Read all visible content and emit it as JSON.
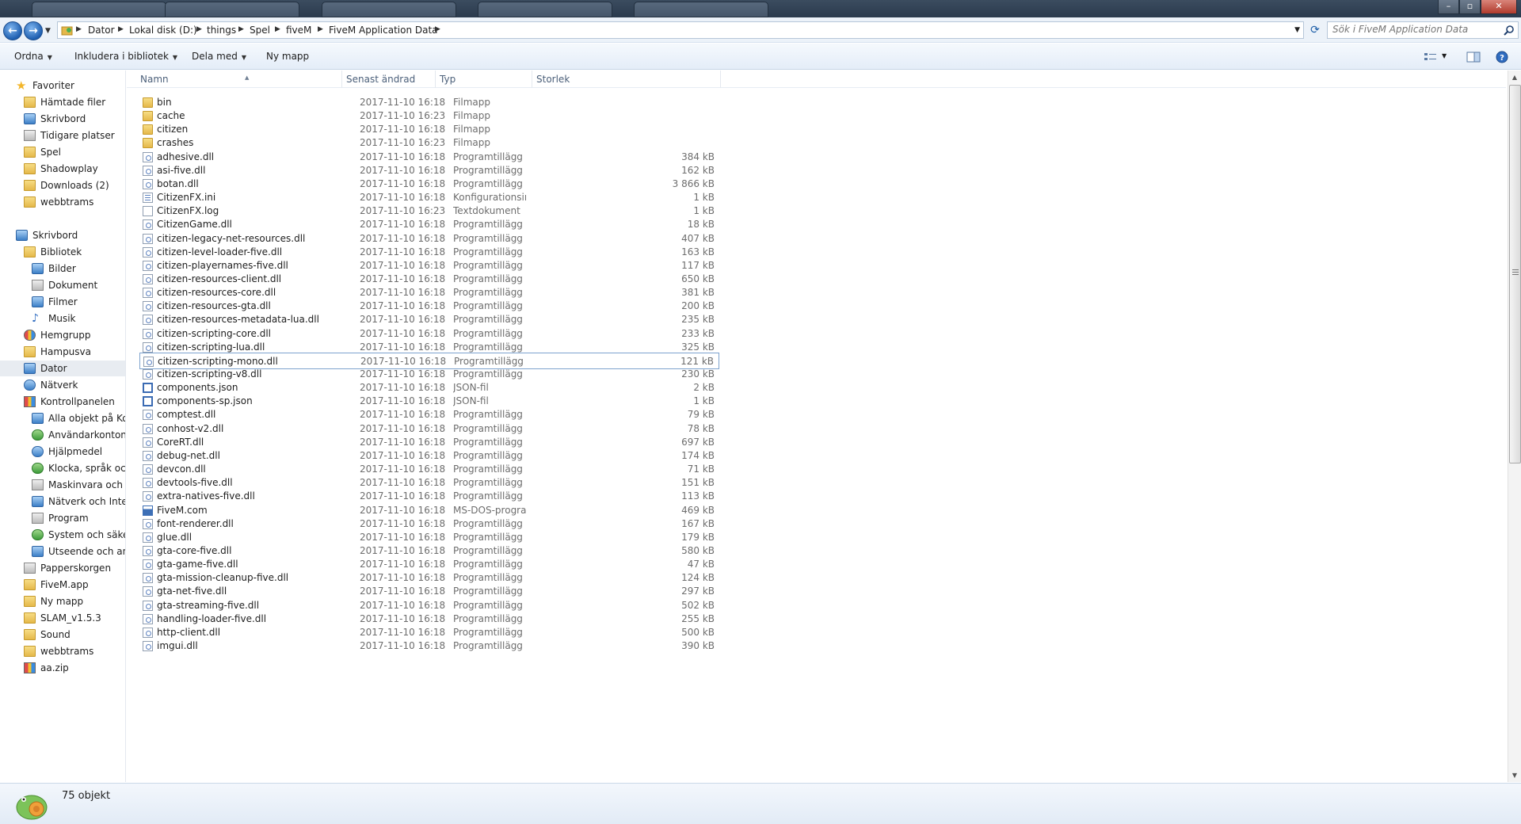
{
  "address_bar": {
    "crumbs": [
      "Dator",
      "Lokal disk (D:)",
      "things",
      "Spel",
      "fiveM",
      "FiveM Application Data"
    ],
    "search_placeholder": "Sök i FiveM Application Data"
  },
  "toolbar": {
    "organize": "Ordna",
    "include_library": "Inkludera i bibliotek",
    "share_with": "Dela med",
    "new_folder": "Ny mapp"
  },
  "nav": {
    "items": [
      {
        "label": "Favoriter",
        "icon": "star-icon"
      },
      {
        "label": "Hämtade filer",
        "icon": "downloads-icon"
      },
      {
        "label": "Skrivbord",
        "icon": "desktop-icon"
      },
      {
        "label": "Tidigare platser",
        "icon": "recent-places-icon"
      },
      {
        "label": "Spel",
        "icon": "folder-icon"
      },
      {
        "label": "Shadowplay",
        "icon": "folder-icon"
      },
      {
        "label": "Downloads (2)",
        "icon": "folder-icon"
      },
      {
        "label": "webbtrams",
        "icon": "folder-icon"
      },
      {
        "label": "Skrivbord",
        "icon": "desktop-icon"
      },
      {
        "label": "Bibliotek",
        "icon": "library-icon"
      },
      {
        "label": "Bilder",
        "icon": "pictures-icon"
      },
      {
        "label": "Dokument",
        "icon": "documents-icon"
      },
      {
        "label": "Filmer",
        "icon": "videos-icon"
      },
      {
        "label": "Musik",
        "icon": "music-icon"
      },
      {
        "label": "Hemgrupp",
        "icon": "homegroup-icon"
      },
      {
        "label": "Hampusva",
        "icon": "user-folder-icon"
      },
      {
        "label": "Dator",
        "icon": "computer-icon"
      },
      {
        "label": "Nätverk",
        "icon": "network-icon"
      },
      {
        "label": "Kontrollpanelen",
        "icon": "control-panel-icon"
      },
      {
        "label": "Alla objekt på Kon",
        "icon": "control-panel-item-icon"
      },
      {
        "label": "Användarkonton c",
        "icon": "user-accounts-icon"
      },
      {
        "label": "Hjälpmedel",
        "icon": "accessibility-icon"
      },
      {
        "label": "Klocka, språk och",
        "icon": "clock-language-icon"
      },
      {
        "label": "Maskinvara och lju",
        "icon": "hardware-sound-icon"
      },
      {
        "label": "Nätverk och Interr",
        "icon": "network-internet-icon"
      },
      {
        "label": "Program",
        "icon": "programs-icon"
      },
      {
        "label": "System och säkerh",
        "icon": "system-security-icon"
      },
      {
        "label": "Utseende och anp",
        "icon": "appearance-icon"
      },
      {
        "label": "Papperskorgen",
        "icon": "recycle-bin-icon"
      },
      {
        "label": "FiveM.app",
        "icon": "folder-icon"
      },
      {
        "label": "Ny mapp",
        "icon": "folder-icon"
      },
      {
        "label": "SLAM_v1.5.3",
        "icon": "folder-icon"
      },
      {
        "label": "Sound",
        "icon": "folder-icon"
      },
      {
        "label": "webbtrams",
        "icon": "folder-icon"
      },
      {
        "label": "aa.zip",
        "icon": "zip-archive-icon"
      }
    ],
    "selected": "Dator"
  },
  "columns": [
    "Namn",
    "Senast ändrad",
    "Typ",
    "Storlek"
  ],
  "files": [
    {
      "name": "bin",
      "date": "2017-11-10 16:18",
      "type": "Filmapp",
      "size": "",
      "icon": "folder-icon"
    },
    {
      "name": "cache",
      "date": "2017-11-10 16:23",
      "type": "Filmapp",
      "size": "",
      "icon": "folder-icon"
    },
    {
      "name": "citizen",
      "date": "2017-11-10 16:18",
      "type": "Filmapp",
      "size": "",
      "icon": "folder-icon"
    },
    {
      "name": "crashes",
      "date": "2017-11-10 16:23",
      "type": "Filmapp",
      "size": "",
      "icon": "folder-icon"
    },
    {
      "name": "adhesive.dll",
      "date": "2017-11-10 16:18",
      "type": "Programtillägg",
      "size": "384 kB",
      "icon": "dll-file-icon"
    },
    {
      "name": "asi-five.dll",
      "date": "2017-11-10 16:18",
      "type": "Programtillägg",
      "size": "162 kB",
      "icon": "dll-file-icon"
    },
    {
      "name": "botan.dll",
      "date": "2017-11-10 16:18",
      "type": "Programtillägg",
      "size": "3 866 kB",
      "icon": "dll-file-icon"
    },
    {
      "name": "CitizenFX.ini",
      "date": "2017-11-10 16:18",
      "type": "Konfigurationsinst...",
      "size": "1 kB",
      "icon": "ini-file-icon"
    },
    {
      "name": "CitizenFX.log",
      "date": "2017-11-10 16:23",
      "type": "Textdokument",
      "size": "1 kB",
      "icon": "text-file-icon"
    },
    {
      "name": "CitizenGame.dll",
      "date": "2017-11-10 16:18",
      "type": "Programtillägg",
      "size": "18 kB",
      "icon": "dll-file-icon"
    },
    {
      "name": "citizen-legacy-net-resources.dll",
      "date": "2017-11-10 16:18",
      "type": "Programtillägg",
      "size": "407 kB",
      "icon": "dll-file-icon"
    },
    {
      "name": "citizen-level-loader-five.dll",
      "date": "2017-11-10 16:18",
      "type": "Programtillägg",
      "size": "163 kB",
      "icon": "dll-file-icon"
    },
    {
      "name": "citizen-playernames-five.dll",
      "date": "2017-11-10 16:18",
      "type": "Programtillägg",
      "size": "117 kB",
      "icon": "dll-file-icon"
    },
    {
      "name": "citizen-resources-client.dll",
      "date": "2017-11-10 16:18",
      "type": "Programtillägg",
      "size": "650 kB",
      "icon": "dll-file-icon"
    },
    {
      "name": "citizen-resources-core.dll",
      "date": "2017-11-10 16:18",
      "type": "Programtillägg",
      "size": "381 kB",
      "icon": "dll-file-icon"
    },
    {
      "name": "citizen-resources-gta.dll",
      "date": "2017-11-10 16:18",
      "type": "Programtillägg",
      "size": "200 kB",
      "icon": "dll-file-icon"
    },
    {
      "name": "citizen-resources-metadata-lua.dll",
      "date": "2017-11-10 16:18",
      "type": "Programtillägg",
      "size": "235 kB",
      "icon": "dll-file-icon"
    },
    {
      "name": "citizen-scripting-core.dll",
      "date": "2017-11-10 16:18",
      "type": "Programtillägg",
      "size": "233 kB",
      "icon": "dll-file-icon"
    },
    {
      "name": "citizen-scripting-lua.dll",
      "date": "2017-11-10 16:18",
      "type": "Programtillägg",
      "size": "325 kB",
      "icon": "dll-file-icon"
    },
    {
      "name": "citizen-scripting-mono.dll",
      "date": "2017-11-10 16:18",
      "type": "Programtillägg",
      "size": "121 kB",
      "icon": "dll-file-icon"
    },
    {
      "name": "citizen-scripting-v8.dll",
      "date": "2017-11-10 16:18",
      "type": "Programtillägg",
      "size": "230 kB",
      "icon": "dll-file-icon"
    },
    {
      "name": "components.json",
      "date": "2017-11-10 16:18",
      "type": "JSON-fil",
      "size": "2 kB",
      "icon": "json-file-icon"
    },
    {
      "name": "components-sp.json",
      "date": "2017-11-10 16:18",
      "type": "JSON-fil",
      "size": "1 kB",
      "icon": "json-file-icon"
    },
    {
      "name": "comptest.dll",
      "date": "2017-11-10 16:18",
      "type": "Programtillägg",
      "size": "79 kB",
      "icon": "dll-file-icon"
    },
    {
      "name": "conhost-v2.dll",
      "date": "2017-11-10 16:18",
      "type": "Programtillägg",
      "size": "78 kB",
      "icon": "dll-file-icon"
    },
    {
      "name": "CoreRT.dll",
      "date": "2017-11-10 16:18",
      "type": "Programtillägg",
      "size": "697 kB",
      "icon": "dll-file-icon"
    },
    {
      "name": "debug-net.dll",
      "date": "2017-11-10 16:18",
      "type": "Programtillägg",
      "size": "174 kB",
      "icon": "dll-file-icon"
    },
    {
      "name": "devcon.dll",
      "date": "2017-11-10 16:18",
      "type": "Programtillägg",
      "size": "71 kB",
      "icon": "dll-file-icon"
    },
    {
      "name": "devtools-five.dll",
      "date": "2017-11-10 16:18",
      "type": "Programtillägg",
      "size": "151 kB",
      "icon": "dll-file-icon"
    },
    {
      "name": "extra-natives-five.dll",
      "date": "2017-11-10 16:18",
      "type": "Programtillägg",
      "size": "113 kB",
      "icon": "dll-file-icon"
    },
    {
      "name": "FiveM.com",
      "date": "2017-11-10 16:18",
      "type": "MS-DOS-program",
      "size": "469 kB",
      "icon": "executable-file-icon"
    },
    {
      "name": "font-renderer.dll",
      "date": "2017-11-10 16:18",
      "type": "Programtillägg",
      "size": "167 kB",
      "icon": "dll-file-icon"
    },
    {
      "name": "glue.dll",
      "date": "2017-11-10 16:18",
      "type": "Programtillägg",
      "size": "179 kB",
      "icon": "dll-file-icon"
    },
    {
      "name": "gta-core-five.dll",
      "date": "2017-11-10 16:18",
      "type": "Programtillägg",
      "size": "580 kB",
      "icon": "dll-file-icon"
    },
    {
      "name": "gta-game-five.dll",
      "date": "2017-11-10 16:18",
      "type": "Programtillägg",
      "size": "47 kB",
      "icon": "dll-file-icon"
    },
    {
      "name": "gta-mission-cleanup-five.dll",
      "date": "2017-11-10 16:18",
      "type": "Programtillägg",
      "size": "124 kB",
      "icon": "dll-file-icon"
    },
    {
      "name": "gta-net-five.dll",
      "date": "2017-11-10 16:18",
      "type": "Programtillägg",
      "size": "297 kB",
      "icon": "dll-file-icon"
    },
    {
      "name": "gta-streaming-five.dll",
      "date": "2017-11-10 16:18",
      "type": "Programtillägg",
      "size": "502 kB",
      "icon": "dll-file-icon"
    },
    {
      "name": "handling-loader-five.dll",
      "date": "2017-11-10 16:18",
      "type": "Programtillägg",
      "size": "255 kB",
      "icon": "dll-file-icon"
    },
    {
      "name": "http-client.dll",
      "date": "2017-11-10 16:18",
      "type": "Programtillägg",
      "size": "500 kB",
      "icon": "dll-file-icon"
    },
    {
      "name": "imgui.dll",
      "date": "2017-11-10 16:18",
      "type": "Programtillägg",
      "size": "390 kB",
      "icon": "dll-file-icon"
    }
  ],
  "focused_file": "citizen-scripting-mono.dll",
  "status": {
    "count_text": "75 objekt"
  },
  "colors": {
    "accent": "#1f5fb0",
    "folder": "#e5b84a",
    "header_text": "#4c607a",
    "selection_border": "#7da2ce"
  }
}
